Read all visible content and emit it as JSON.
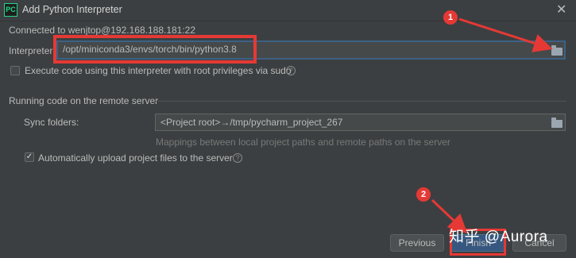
{
  "window": {
    "title": "Add Python Interpreter",
    "app_icon_text": "PC"
  },
  "connection": {
    "status": "Connected to wenjtop@192.168.188.181:22"
  },
  "interpreter": {
    "label": "Interpreter:",
    "value": "/opt/miniconda3/envs/torch/bin/python3.8"
  },
  "sudo": {
    "label": "Execute code using this interpreter with root privileges via sudo",
    "checked": false
  },
  "remote_section": {
    "title": "Running code on the remote server",
    "sync_label": "Sync folders:",
    "sync_value": "<Project root>→/tmp/pycharm_project_267",
    "sync_hint": "Mappings between local project paths and remote paths on the server",
    "auto_upload_label": "Automatically upload project files to the server",
    "auto_upload_checked": true
  },
  "buttons": {
    "previous": "Previous",
    "finish": "Finish",
    "cancel": "Cancel"
  },
  "annotations": {
    "badge1": "1",
    "badge2": "2",
    "highlight_color": "#e53935"
  },
  "watermark": "知乎 @Aurora"
}
